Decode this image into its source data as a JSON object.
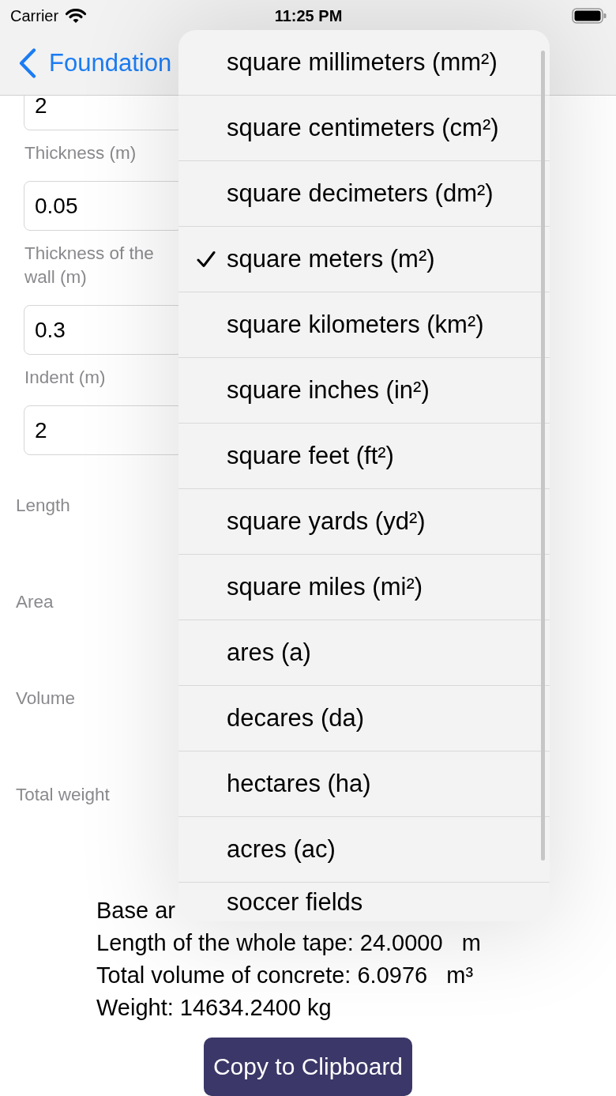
{
  "status_bar": {
    "carrier": "Carrier",
    "time": "11:25 PM"
  },
  "nav_bar": {
    "back_label": "Foundation"
  },
  "form": {
    "fields": [
      {
        "value": "2"
      },
      {
        "label": "Thickness (m)",
        "value": "0.05"
      },
      {
        "label": "Thickness of the wall (m)",
        "value": "0.3"
      },
      {
        "label": "Indent (m)",
        "value": "2"
      }
    ]
  },
  "result_rows": [
    "Length",
    "Area",
    "Volume",
    "Total weight"
  ],
  "results": [
    "Base ar",
    "Length of the whole tape: 24.0000   m",
    "Total volume of concrete: 6.0976   m³",
    "Weight: 14634.2400 kg"
  ],
  "copy_button": {
    "label": "Copy to Clipboard"
  },
  "unit_menu": {
    "items": [
      {
        "label": "square millimeters (mm²)",
        "selected": false
      },
      {
        "label": "square centimeters (cm²)",
        "selected": false
      },
      {
        "label": "square decimeters (dm²)",
        "selected": false
      },
      {
        "label": "square meters (m²)",
        "selected": true
      },
      {
        "label": "square kilometers (km²)",
        "selected": false
      },
      {
        "label": "square inches (in²)",
        "selected": false
      },
      {
        "label": "square feet (ft²)",
        "selected": false
      },
      {
        "label": "square yards (yd²)",
        "selected": false
      },
      {
        "label": "square miles (mi²)",
        "selected": false
      },
      {
        "label": "ares (a)",
        "selected": false
      },
      {
        "label": "decares (da)",
        "selected": false
      },
      {
        "label": "hectares (ha)",
        "selected": false
      },
      {
        "label": "acres (ac)",
        "selected": false
      },
      {
        "label": "soccer fields",
        "selected": false
      }
    ]
  }
}
